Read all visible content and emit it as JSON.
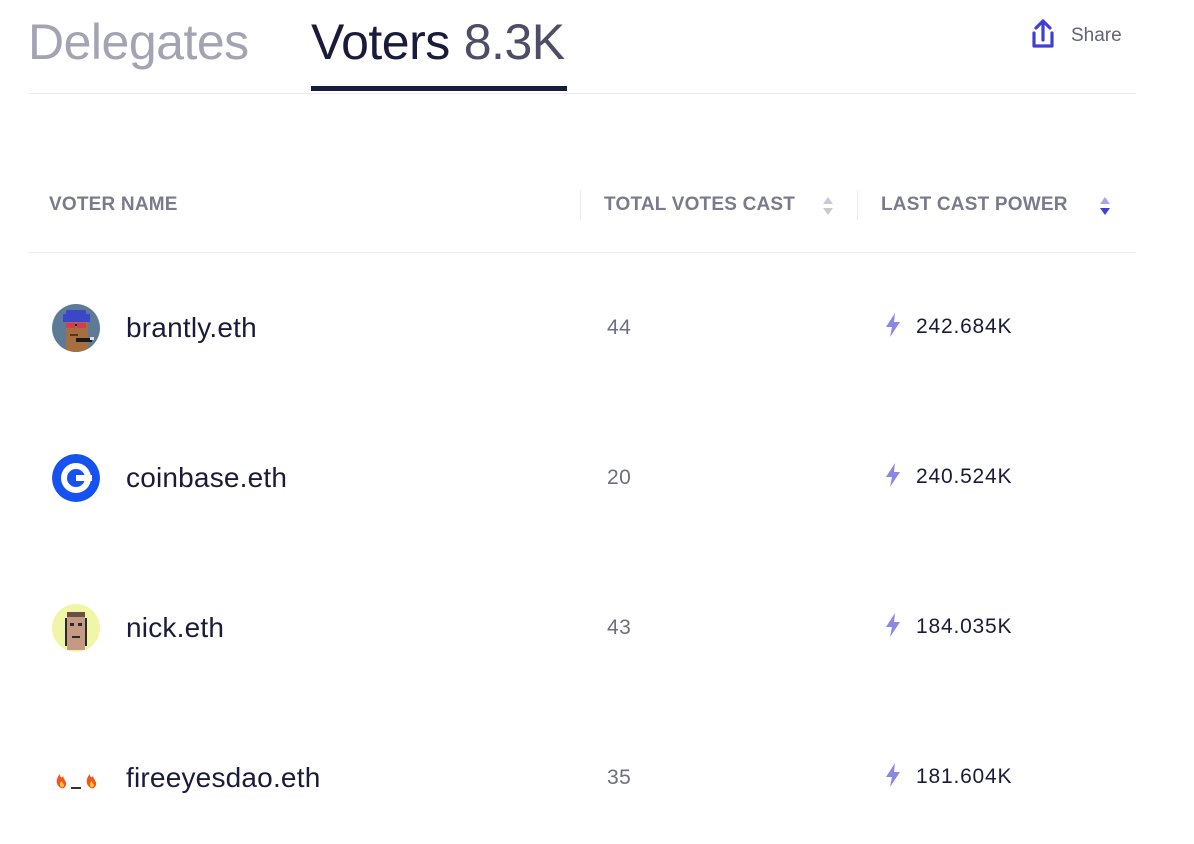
{
  "tabs": {
    "delegates_label": "Delegates",
    "voters_label": "Voters",
    "voters_count": "8.3K"
  },
  "share": {
    "label": "Share",
    "icon": "share-upload-icon"
  },
  "table": {
    "headers": {
      "name": "VOTER NAME",
      "votes": "TOTAL VOTES CAST",
      "power": "LAST CAST POWER"
    },
    "sort": {
      "column": "last_cast_power",
      "direction": "descending"
    },
    "rows": [
      {
        "name": "brantly.eth",
        "votes": "44",
        "power": "242.684K",
        "avatar_icon": "punk-avatar"
      },
      {
        "name": "coinbase.eth",
        "votes": "20",
        "power": "240.524K",
        "avatar_icon": "coinbase-logo"
      },
      {
        "name": "nick.eth",
        "votes": "43",
        "power": "184.035K",
        "avatar_icon": "pixel-face-avatar"
      },
      {
        "name": "fireeyesdao.eth",
        "votes": "35",
        "power": "181.604K",
        "avatar_icon": "fire-eyes-avatar"
      }
    ]
  },
  "colors": {
    "accent": "#3f3fd6",
    "bolt": "#8b87e3",
    "text": "#1a1b3a",
    "muted": "#7a7a8c"
  }
}
